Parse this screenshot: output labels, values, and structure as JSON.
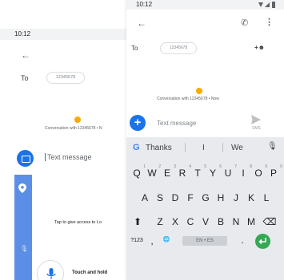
{
  "left": {
    "status_time": "10:12",
    "to_label": "To",
    "recipient": "12345678",
    "conversation_label": "Conversation with 12345678 • N",
    "compose_placeholder": "Text message",
    "location_text": "Tap to give access to Lo",
    "voice_hint": "Touch and hold"
  },
  "right": {
    "status_time": "10:12",
    "to_label": "To",
    "recipient": "12345678",
    "conversation_label": "Conversation with 12345678 • Now",
    "compose_placeholder": "Text message",
    "send_sub": "SMS",
    "suggestions": [
      "Thanks",
      "I",
      "We"
    ],
    "keys_row1": [
      {
        "k": "Q",
        "n": "1"
      },
      {
        "k": "W",
        "n": "2"
      },
      {
        "k": "E",
        "n": "3"
      },
      {
        "k": "R",
        "n": "4"
      },
      {
        "k": "T",
        "n": "5"
      },
      {
        "k": "Y",
        "n": "6"
      },
      {
        "k": "U",
        "n": "7"
      },
      {
        "k": "I",
        "n": "8"
      },
      {
        "k": "O",
        "n": "9"
      },
      {
        "k": "P",
        "n": "0"
      }
    ],
    "keys_row2": [
      "A",
      "S",
      "D",
      "F",
      "G",
      "H",
      "J",
      "K",
      "L"
    ],
    "keys_row3": [
      "Z",
      "X",
      "C",
      "V",
      "B",
      "N",
      "M"
    ],
    "symbols_key": "?123",
    "comma_key": ",",
    "period_key": ".",
    "space_label": "EN • ES"
  },
  "colors": {
    "accent": "#1a73e8",
    "enter": "#34a853",
    "keyboard_bg": "#e8eaed"
  },
  "icons": {
    "back": "arrow-left-icon",
    "phone": "phone-icon",
    "more": "more-vert-icon",
    "add_person": "add-person-icon",
    "send": "send-icon",
    "mic": "mic-icon"
  }
}
